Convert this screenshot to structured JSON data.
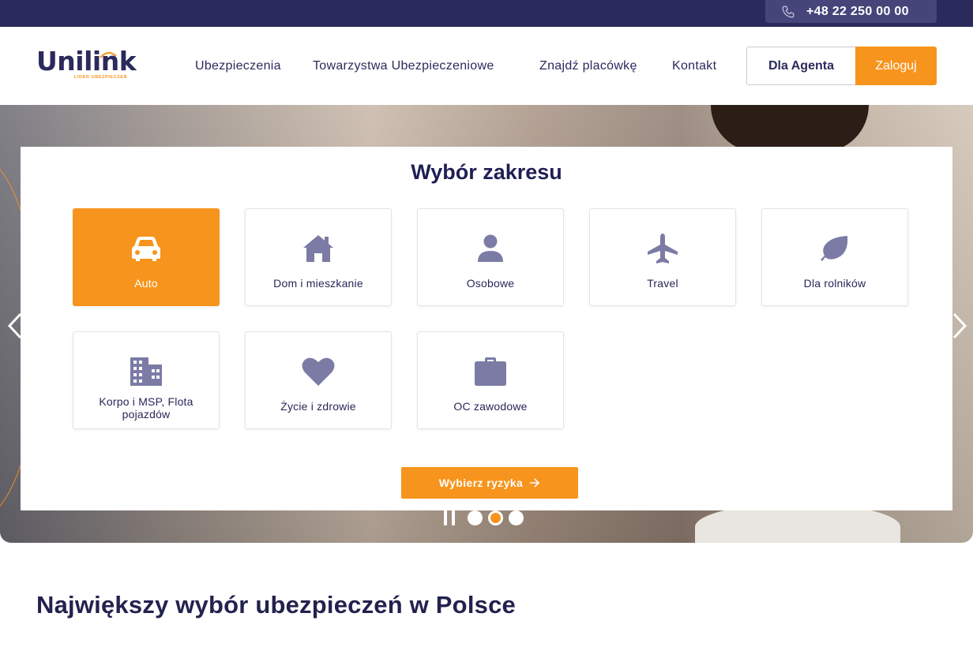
{
  "topbar": {
    "phone": "+48 22 250 00 00"
  },
  "header": {
    "logo_name": "Unilink",
    "logo_tagline": "LIDER UBEZPIECZEŃ",
    "nav": [
      "Ubezpieczenia",
      "Towarzystwa Ubezpieczeniowe",
      "Znajdź placówkę",
      "Kontakt"
    ],
    "agent_label": "Dla Agenta",
    "login_label": "Zaloguj"
  },
  "panel": {
    "title": "Wybór zakresu",
    "tiles": [
      {
        "label": "Auto",
        "icon": "car-icon",
        "active": true
      },
      {
        "label": "Dom i mieszkanie",
        "icon": "house-icon",
        "active": false
      },
      {
        "label": "Osobowe",
        "icon": "person-icon",
        "active": false
      },
      {
        "label": "Travel",
        "icon": "airplane-icon",
        "active": false
      },
      {
        "label": "Dla rolników",
        "icon": "leaf-icon",
        "active": false
      },
      {
        "label": "Korpo i MSP, Flota pojazdów",
        "icon": "building-icon",
        "active": false
      },
      {
        "label": "Życie i zdrowie",
        "icon": "heart-icon",
        "active": false
      },
      {
        "label": "OC zawodowe",
        "icon": "briefcase-icon",
        "active": false
      }
    ],
    "cta_label": "Wybierz ryzyka"
  },
  "carousel": {
    "slides": 3,
    "active_slide": 2
  },
  "colors": {
    "navy": "#2a2a5c",
    "accent": "#f7941d",
    "icon": "#7b7ba6"
  },
  "section": {
    "title": "Największy wybór ubezpieczeń w Polsce"
  }
}
